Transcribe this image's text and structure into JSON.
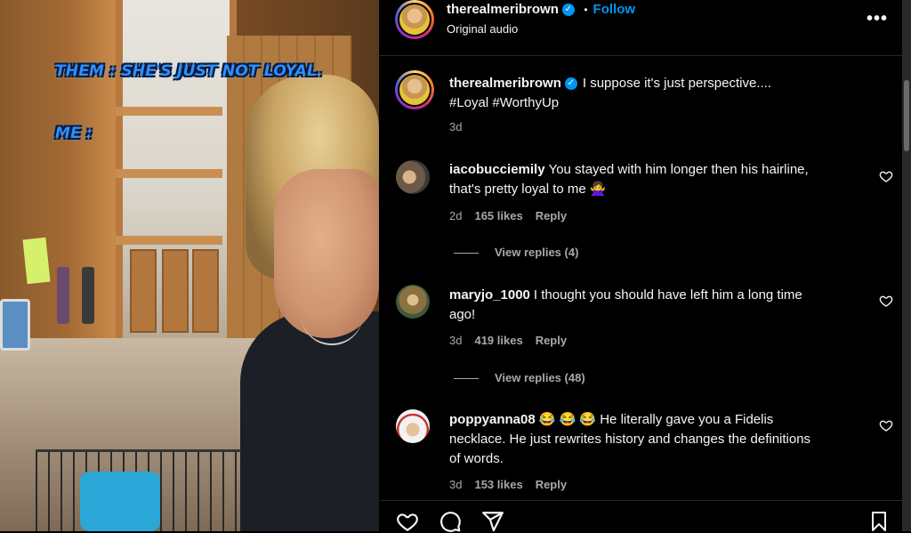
{
  "video": {
    "caption_line1": "THEM : SHE'S JUST NOT LOYAL.",
    "caption_line2": "ME :"
  },
  "header": {
    "username": "therealmeribrown",
    "follow_label": "Follow",
    "separator": "•",
    "audio": "Original audio",
    "more_label": "•••"
  },
  "post": {
    "username": "therealmeribrown",
    "caption_line1": "I suppose it's just perspective....",
    "caption_line2": "#Loyal #WorthyUp",
    "time": "3d"
  },
  "comments": [
    {
      "username": "iacobucciemily",
      "text_line1": "You stayed with him longer then his hairline,",
      "text_line2": "that's pretty loyal to me 🙅‍♀️",
      "time": "2d",
      "likes": "165 likes",
      "reply": "Reply",
      "view_replies": "View replies (4)"
    },
    {
      "username": "maryjo_1000",
      "text_line1": "I thought you should have left him a long time",
      "text_line2": "ago!",
      "time": "3d",
      "likes": "419 likes",
      "reply": "Reply",
      "view_replies": "View replies (48)"
    },
    {
      "username": "poppyanna08",
      "text_line1": "😂 😂 😂  He literally gave you a Fidelis",
      "text_line2": "necklace. He just rewrites history and changes the definitions",
      "text_line3": "of words.",
      "time": "3d",
      "likes": "153 likes",
      "reply": "Reply"
    }
  ],
  "colors": {
    "accent": "#0095f6",
    "background": "#000000",
    "muted_text": "#a8a8a8",
    "caption_blue": "#2f8fff"
  },
  "icons": [
    "verified-badge-icon",
    "heart-icon",
    "comment-icon",
    "share-icon",
    "bookmark-icon",
    "more-options-icon"
  ]
}
